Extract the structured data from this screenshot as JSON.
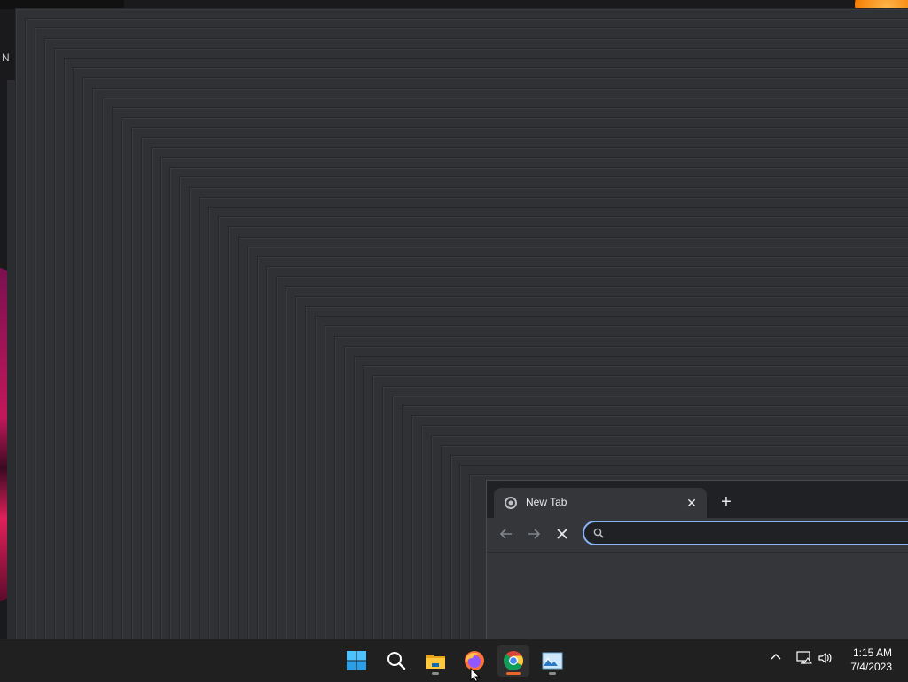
{
  "desktop": {
    "partial_label": "N"
  },
  "browser": {
    "tab": {
      "title": "New Tab",
      "close_icon": "close-icon",
      "favicon": "chrome-favicon"
    },
    "new_tab_icon": "plus-icon",
    "toolbar": {
      "back_icon": "arrow-left-icon",
      "forward_icon": "arrow-right-icon",
      "stop_icon": "close-icon"
    },
    "omnibox": {
      "value": "",
      "placeholder": "",
      "icon": "search-icon"
    }
  },
  "taskbar": {
    "items": [
      {
        "name": "Start",
        "icon": "windows-logo-icon"
      },
      {
        "name": "Search",
        "icon": "search-icon"
      },
      {
        "name": "File Explorer",
        "icon": "folder-icon"
      },
      {
        "name": "Firefox",
        "icon": "firefox-icon"
      },
      {
        "name": "Google Chrome",
        "icon": "chrome-icon"
      },
      {
        "name": "Image viewer",
        "icon": "image-icon"
      }
    ],
    "tray": {
      "overflow_icon": "chevron-up-icon",
      "network_icon": "network-icon",
      "volume_icon": "speaker-icon"
    },
    "clock": {
      "time": "1:15 AM",
      "date": "7/4/2023"
    }
  },
  "colors": {
    "accent": "#8ab4f8",
    "taskbar_bg": "#202020",
    "window_bg": "#35363a",
    "chrome_indicator": "#e8662a"
  }
}
